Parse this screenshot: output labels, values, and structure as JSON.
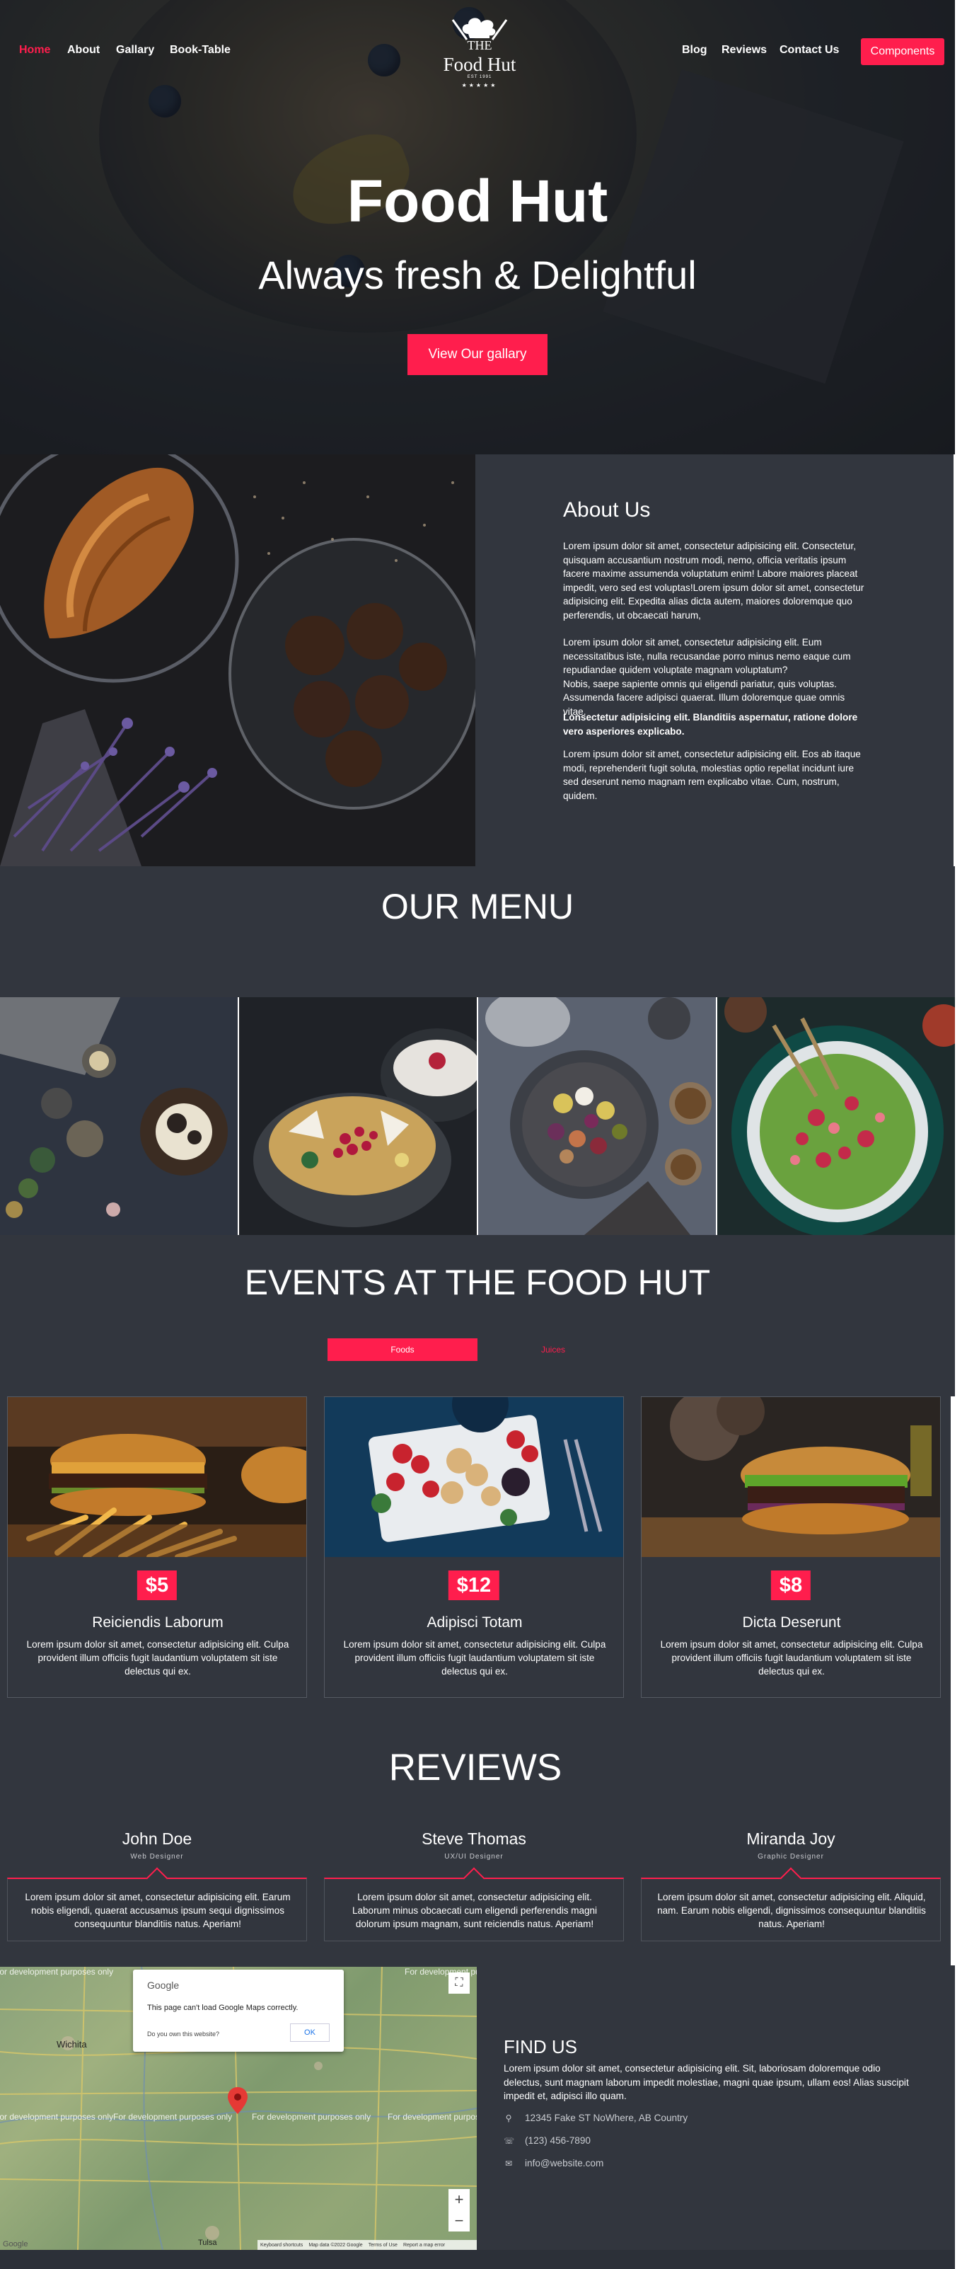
{
  "nav": {
    "left": [
      "Home",
      "About",
      "Gallary",
      "Book-Table"
    ],
    "right": [
      "Blog",
      "Reviews",
      "Contact Us"
    ],
    "components_button": "Components"
  },
  "logo": {
    "the": "THE",
    "name": "Food Hut",
    "est": "EST 1991",
    "stars": "★★★★★"
  },
  "hero": {
    "title": "Food Hut",
    "subtitle": "Always fresh & Delightful",
    "button": "View Our gallary"
  },
  "about": {
    "title": "About Us",
    "p1": "Lorem ipsum dolor sit amet, consectetur adipisicing elit. Consectetur, quisquam accusantium nostrum modi, nemo, officia veritatis ipsum facere maxime assumenda voluptatum enim! Labore maiores placeat impedit, vero sed est voluptas!Lorem ipsum dolor sit amet, consectetur adipisicing elit. Expedita alias dicta autem, maiores doloremque quo perferendis, ut obcaecati harum,",
    "p2": "Lorem ipsum dolor sit amet, consectetur adipisicing elit. Eum necessitatibus iste, nulla recusandae porro minus nemo eaque cum repudiandae quidem voluptate magnam voluptatum?\nNobis, saepe sapiente omnis qui eligendi pariatur, quis voluptas. Assumenda facere adipisci quaerat. Illum doloremque quae omnis vitae.",
    "p3": "Lonsectetur adipisicing elit. Blanditiis aspernatur, ratione dolore vero asperiores explicabo.",
    "p4": "Lorem ipsum dolor sit amet, consectetur adipisicing elit. Eos ab itaque modi, reprehenderit fugit soluta, molestias optio repellat incidunt iure sed deserunt nemo magnam rem explicabo vitae. Cum, nostrum, quidem."
  },
  "menu": {
    "title": "OUR MENU"
  },
  "events": {
    "title": "EVENTS AT THE FOOD HUT",
    "tabs": [
      "Foods",
      "Juices"
    ],
    "cards": [
      {
        "price": "$5",
        "title": "Reiciendis Laborum",
        "desc": "Lorem ipsum dolor sit amet, consectetur adipisicing elit. Culpa provident illum officiis fugit laudantium voluptatem sit iste delectus qui ex."
      },
      {
        "price": "$12",
        "title": "Adipisci Totam",
        "desc": "Lorem ipsum dolor sit amet, consectetur adipisicing elit. Culpa provident illum officiis fugit laudantium voluptatem sit iste delectus qui ex."
      },
      {
        "price": "$8",
        "title": "Dicta Deserunt",
        "desc": "Lorem ipsum dolor sit amet, consectetur adipisicing elit. Culpa provident illum officiis fugit laudantium voluptatem sit iste delectus qui ex."
      }
    ]
  },
  "reviews": {
    "title": "REVIEWS",
    "items": [
      {
        "name": "John Doe",
        "role": "Web Designer",
        "text": "Lorem ipsum dolor sit amet, consectetur adipisicing elit. Earum nobis eligendi, quaerat accusamus ipsum sequi dignissimos consequuntur blanditiis natus. Aperiam!"
      },
      {
        "name": "Steve Thomas",
        "role": "UX/UI Designer",
        "text": "Lorem ipsum dolor sit amet, consectetur adipisicing elit. Laborum minus obcaecati cum eligendi perferendis magni dolorum ipsum magnam, sunt reiciendis natus. Aperiam!"
      },
      {
        "name": "Miranda Joy",
        "role": "Graphic Designer",
        "text": "Lorem ipsum dolor sit amet, consectetur adipisicing elit. Aliquid, nam. Earum nobis eligendi, dignissimos consequuntur blanditiis natus. Aperiam!"
      }
    ]
  },
  "map": {
    "dev_text": "For development purposes only",
    "brand": "Google",
    "message": "This page can't load Google Maps correctly.",
    "own": "Do you own this website?",
    "ok": "OK",
    "footer": [
      "Keyboard shortcuts",
      "Map data ©2022 Google",
      "Terms of Use",
      "Report a map error"
    ],
    "zoom_in": "+",
    "zoom_out": "−",
    "places": [
      "Wichita",
      "Tulsa"
    ],
    "watermark": "Google"
  },
  "find_us": {
    "title": "FIND US",
    "desc": "Lorem ipsum dolor sit amet, consectetur adipisicing elit. Sit, laboriosam doloremque odio delectus, sunt magnam laborum impedit molestiae, magni quae ipsum, ullam eos! Alias suscipit impedit et, adipisci illo quam.",
    "address": "12345 Fake ST NoWhere, AB Country",
    "phone": "(123) 456-7890",
    "email": "info@website.com"
  },
  "colors": {
    "accent": "#ff1e4d",
    "panel": "#32363e"
  }
}
